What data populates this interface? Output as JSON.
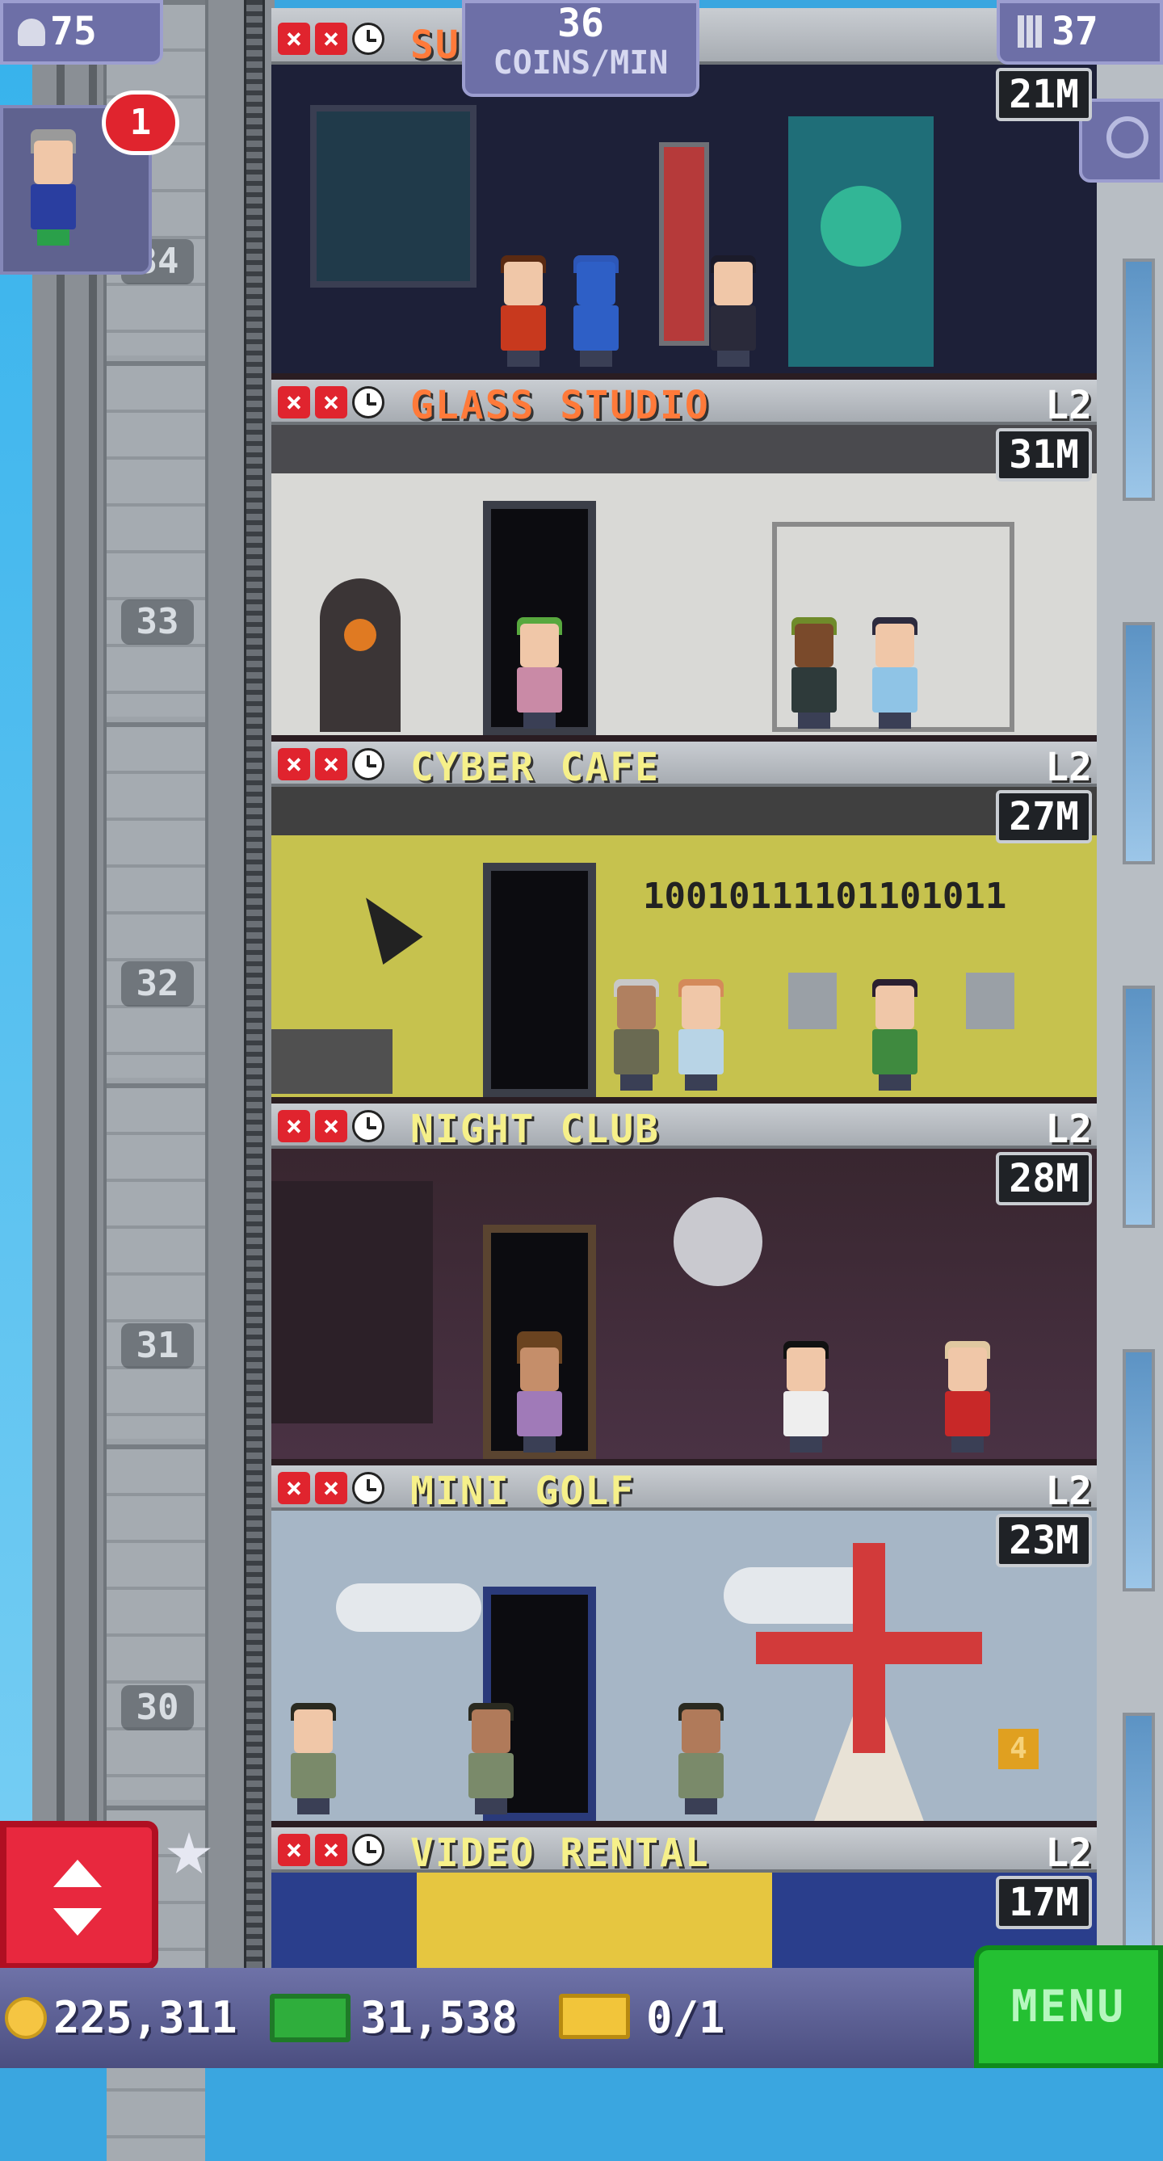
{
  "hud": {
    "population": "75",
    "coins_per_min_value": "36",
    "coins_per_min_label": "COINS/MIN",
    "floor_count": "37",
    "notification_count": "1"
  },
  "shaft": {
    "floor_numbers": [
      "34",
      "33",
      "32",
      "31",
      "30"
    ]
  },
  "floors": [
    {
      "name": "SUPER LAB",
      "level": "",
      "stock": "21M",
      "name_color": "#ff7a3a"
    },
    {
      "name": "GLASS STUDIO",
      "level": "L2",
      "stock": "31M",
      "name_color": "#ff7a3a"
    },
    {
      "name": "CYBER CAFE",
      "level": "L2",
      "stock": "27M",
      "name_color": "#f6f08a",
      "wall_text": "10010111101101011"
    },
    {
      "name": "NIGHT CLUB",
      "level": "L2",
      "stock": "28M",
      "name_color": "#f6f08a"
    },
    {
      "name": "MINI GOLF",
      "level": "L2",
      "stock": "23M",
      "name_color": "#f6f08a",
      "hole_number": "4"
    },
    {
      "name": "VIDEO RENTAL",
      "level": "L2",
      "stock": "17M",
      "name_color": "#f6f08a"
    }
  ],
  "bottom_bar": {
    "coins": "225,311",
    "bux": "31,538",
    "tickets": "0/1",
    "menu_label": "MENU"
  },
  "colors": {
    "coin": "#f5c542",
    "bux": "#2fae3c",
    "ticket": "#f2c53a",
    "menu": "#24c032"
  }
}
